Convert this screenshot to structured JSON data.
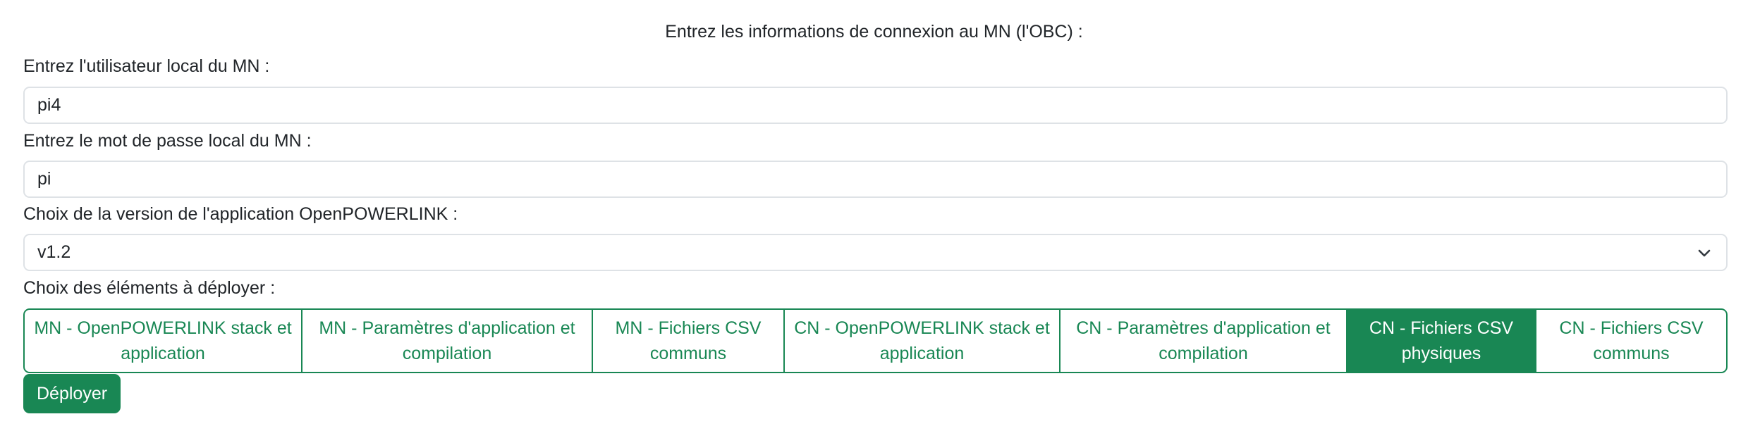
{
  "form": {
    "heading": "Entrez les informations de connexion au MN (l'OBC) :",
    "user_label": "Entrez l'utilisateur local du MN :",
    "user_value": "pi4",
    "password_label": "Entrez le mot de passe local du MN :",
    "password_value": "pi",
    "version_label": "Choix de la version de l'application OpenPOWERLINK :",
    "version_value": "v1.2",
    "elements_label": "Choix des éléments à déployer :",
    "elements": [
      {
        "line1": "MN - OpenPOWERLINK stack et",
        "line2": "application",
        "selected": false
      },
      {
        "line1": "MN - Paramètres d'application et",
        "line2": "compilation",
        "selected": false
      },
      {
        "line1": "MN - Fichiers CSV",
        "line2": "communs",
        "selected": false
      },
      {
        "line1": "CN - OpenPOWERLINK stack et",
        "line2": "application",
        "selected": false
      },
      {
        "line1": "CN - Paramètres d'application et",
        "line2": "compilation",
        "selected": false
      },
      {
        "line1": "CN - Fichiers CSV",
        "line2": "physiques",
        "selected": true
      },
      {
        "line1": "CN - Fichiers CSV",
        "line2": "communs",
        "selected": false
      }
    ],
    "deploy_label": "Déployer",
    "icons": {
      "select_arrow": "chevron-down-icon"
    }
  },
  "colors": {
    "accent": "#198754",
    "border": "#dee2e6",
    "text": "#212529"
  }
}
